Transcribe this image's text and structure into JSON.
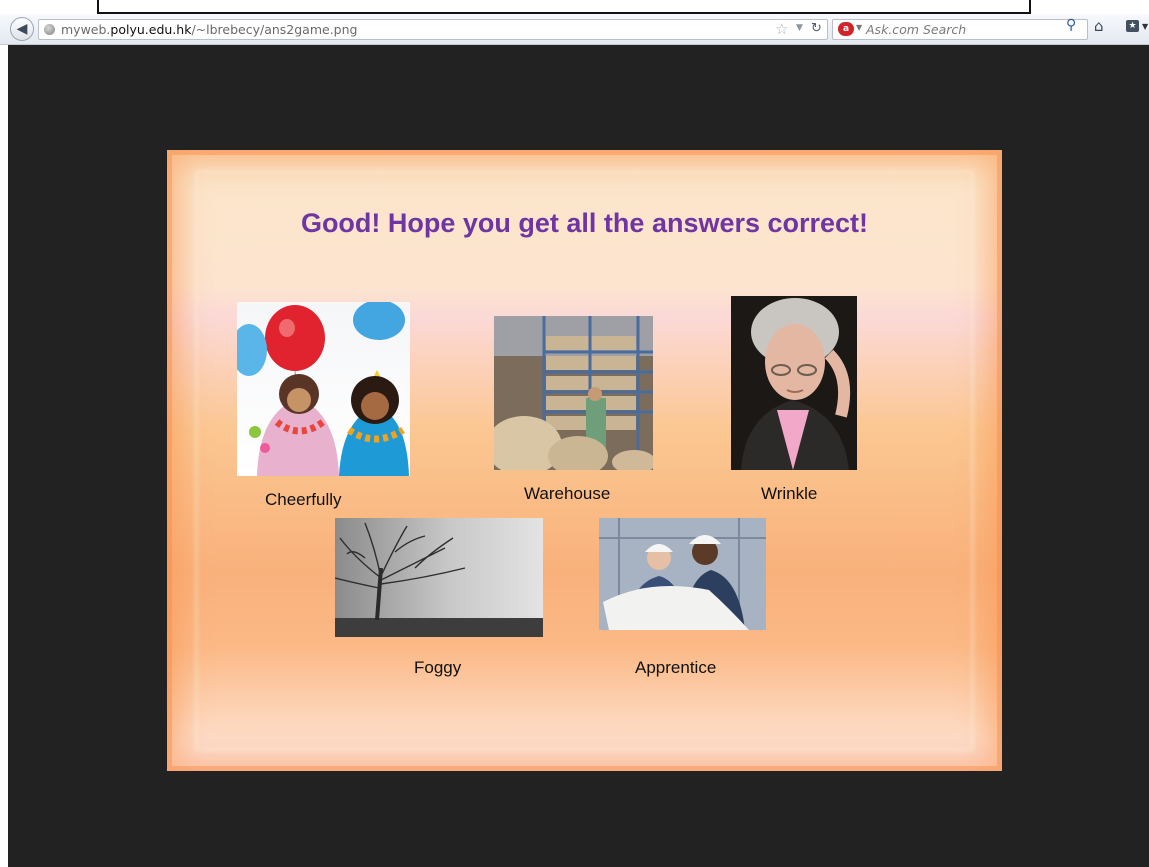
{
  "browser": {
    "url_prefix": "myweb.",
    "url_domain": "polyu.edu.hk",
    "url_path": "/~lbrebecy/ans2game.png",
    "search_placeholder": "Ask.com Search"
  },
  "slide": {
    "title": "Good! Hope you get all the answers correct!",
    "items": [
      {
        "label": "Cheerfully"
      },
      {
        "label": "Warehouse"
      },
      {
        "label": "Wrinkle"
      },
      {
        "label": "Foggy"
      },
      {
        "label": "Apprentice"
      }
    ]
  }
}
